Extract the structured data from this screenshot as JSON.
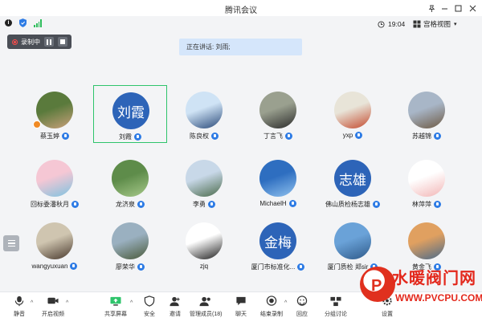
{
  "window": {
    "title": "腾讯会议"
  },
  "status": {
    "time": "19:04",
    "view_mode": "宫格视图"
  },
  "recording": {
    "label": "录制中"
  },
  "speaking": {
    "text": "正在讲话: 刘雨;"
  },
  "participants": [
    {
      "name": "蔡玉婷",
      "avatar": "photo",
      "colors": [
        "#5a7a3c",
        "#c9a07a"
      ],
      "mic": true,
      "badge": true
    },
    {
      "name": "刘霞",
      "avatar": "text",
      "avatar_text": "刘霞",
      "mic": true,
      "selected": true
    },
    {
      "name": "陈良权",
      "avatar": "photo",
      "colors": [
        "#cfe3f5",
        "#2a4a7a"
      ],
      "mic": true
    },
    {
      "name": "丁言飞",
      "avatar": "photo",
      "colors": [
        "#9aa08f",
        "#2b2b2b"
      ],
      "mic": true
    },
    {
      "name": "yxp",
      "avatar": "photo",
      "colors": [
        "#e8e4d8",
        "#c44a2e"
      ],
      "mic": true
    },
    {
      "name": "苏越锦",
      "avatar": "photo",
      "colors": [
        "#a8b6c7",
        "#6e5a44"
      ],
      "mic": true
    },
    {
      "name": "回标委潘秋月",
      "avatar": "photo",
      "colors": [
        "#f5c7d4",
        "#7ec3e0"
      ],
      "mic": true
    },
    {
      "name": "龙济泉",
      "avatar": "photo",
      "colors": [
        "#5e8c4a",
        "#a7c98a"
      ],
      "mic": true
    },
    {
      "name": "李勇",
      "avatar": "photo",
      "colors": [
        "#c8d8e8",
        "#4a6a4a"
      ],
      "mic": true
    },
    {
      "name": "MichaelH",
      "avatar": "photo",
      "colors": [
        "#2e6ec0",
        "#8fc1ee"
      ],
      "mic": true
    },
    {
      "name": "佛山质检杨志雄",
      "avatar": "text",
      "avatar_text": "志雄",
      "mic": true
    },
    {
      "name": "林萍萍",
      "avatar": "photo",
      "colors": [
        "#ffffff",
        "#f2b5b5"
      ],
      "mic": true
    },
    {
      "name": "wangyuxuan",
      "avatar": "photo",
      "colors": [
        "#cfc5b0",
        "#4a3a2e"
      ],
      "mic": true
    },
    {
      "name": "廖荣华",
      "avatar": "photo",
      "colors": [
        "#9ab0c0",
        "#4a5a3a"
      ],
      "mic": true
    },
    {
      "name": "zjq",
      "avatar": "photo",
      "colors": [
        "#ffffff",
        "#1e1e1e"
      ],
      "mic": false
    },
    {
      "name": "厦门市标准化...",
      "avatar": "text",
      "avatar_text": "金梅",
      "mic": true
    },
    {
      "name": "厦门质检 郑sir",
      "avatar": "photo",
      "colors": [
        "#6aa2d8",
        "#2e5a8a"
      ],
      "mic": true
    },
    {
      "name": "黄金飞",
      "avatar": "photo",
      "colors": [
        "#e0a060",
        "#4a6a8a"
      ],
      "mic": true
    }
  ],
  "toolbar": {
    "items": [
      {
        "id": "mute",
        "label": "静音",
        "icon": "microphone-icon"
      },
      {
        "id": "video",
        "label": "开启视频",
        "icon": "camera-icon"
      },
      {
        "id": "share",
        "label": "共享屏幕",
        "icon": "screen-share-icon"
      },
      {
        "id": "security",
        "label": "安全",
        "icon": "shield-icon"
      },
      {
        "id": "invite",
        "label": "邀请",
        "icon": "add-person-icon"
      },
      {
        "id": "members",
        "label": "管理成员(18)",
        "icon": "members-icon"
      },
      {
        "id": "chat",
        "label": "聊天",
        "icon": "chat-icon"
      },
      {
        "id": "record",
        "label": "结束录制",
        "icon": "record-icon"
      },
      {
        "id": "react",
        "label": "回应",
        "icon": "emoji-icon"
      },
      {
        "id": "breakout",
        "label": "分组讨论",
        "icon": "breakout-icon"
      },
      {
        "id": "settings",
        "label": "设置",
        "icon": "gear-icon"
      }
    ]
  },
  "watermark": {
    "chinese": "水暖阀门网",
    "url": "WWW.PVCPU.COM"
  },
  "colors": {
    "accent": "#2d7be5",
    "selected_border": "#2ec46b",
    "record_red": "#ff4b4b"
  }
}
